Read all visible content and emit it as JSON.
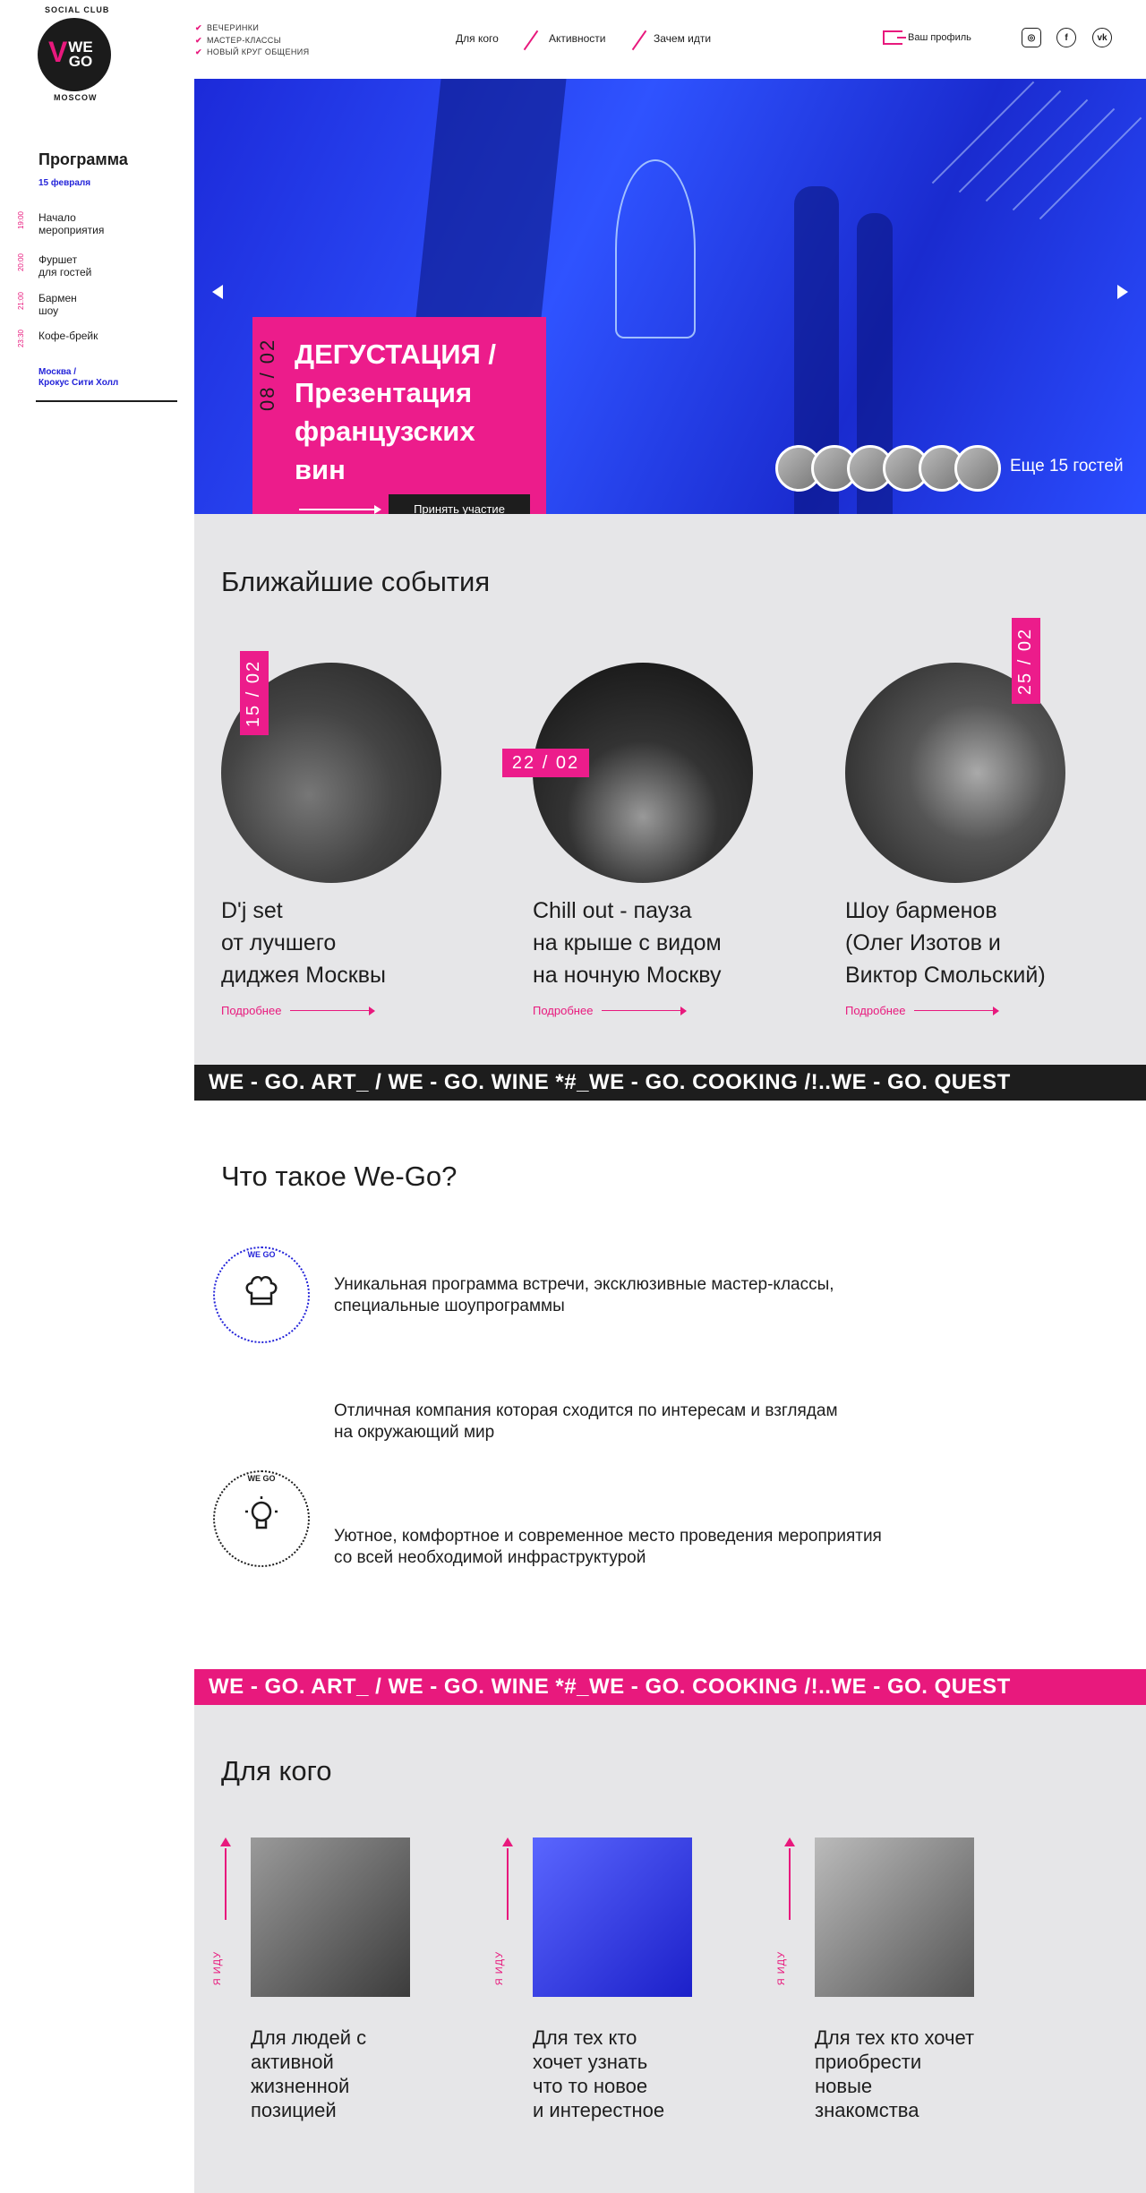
{
  "brand": {
    "ring_top": "SOCIAL CLUB",
    "ring_bottom": "MOSCOW",
    "center": "WE\nGO"
  },
  "checklist": [
    "ВЕЧЕРИНКИ",
    "МАСТЕР-КЛАССЫ",
    "НОВЫЙ КРУГ ОБЩЕНИЯ"
  ],
  "nav": [
    "Для кого",
    "Активности",
    "Зачем идти"
  ],
  "profile_label": "Ваш профиль",
  "socials": [
    "instagram-icon",
    "facebook-icon",
    "vk-icon"
  ],
  "program": {
    "title": "Программа",
    "date": "15 февраля",
    "items": [
      {
        "time": "19:00",
        "label": "Начало\nмероприятия"
      },
      {
        "time": "20:00",
        "label": "Фуршет\nдля гостей"
      },
      {
        "time": "21:00",
        "label": "Бармен\nшоу"
      },
      {
        "time": "23:30",
        "label": "Кофе-брейк"
      }
    ],
    "location": "Москва /\nКрокус Сити Холл"
  },
  "hero": {
    "date": "08 / 02",
    "title": "ДЕГУСТАЦИЯ /\nПрезентация\nфранцузских\nвин",
    "cta": "Принять участие",
    "guests_label": "Еще 15 гостей",
    "avatars_count": 6
  },
  "events": {
    "heading": "Ближайшие события",
    "items": [
      {
        "date": "15 / 02",
        "title": "D'j set\nот лучшего\nдиджея Москвы",
        "more": "Подробнее"
      },
      {
        "date": "22 / 02",
        "title": "Chill out - пауза\nна крыше с видом\nна ночную Москву",
        "more": "Подробнее"
      },
      {
        "date": "25 / 02",
        "title": "Шоу барменов\n(Олег Изотов и\nВиктор Смольский)",
        "more": "Подробнее"
      }
    ]
  },
  "ticker_text": "WE - GO. ART_ / WE - GO. WINE *#_WE - GO. COOKING /!..WE - GO. QUEST",
  "about": {
    "heading": "Что такое We-Go?",
    "badge_text": "WE GO",
    "features": [
      {
        "icon": "chef-hat-icon",
        "color": "#2323d9",
        "text": "Уникальная программа встречи, эксклюзивные мастер-классы,\nспециальные шоупрограммы"
      },
      {
        "icon": "lightbulb-icon",
        "color": "#1d1d1d",
        "text": "Отличная компания которая сходится по интересам и взглядам\nна окружающий мир"
      },
      {
        "icon": "paper-plane-icon",
        "color": "#e8197d",
        "text": "Уютное, комфортное и современное место проведения мероприятия\nсо всей необходимой инфраструктурой"
      }
    ]
  },
  "audience": {
    "heading": "Для кого",
    "side_label": "Я ИДУ",
    "items": [
      {
        "title": "Для людей с\nактивной\nжизненной\nпозицией"
      },
      {
        "title": "Для тех кто\nхочет узнать\nчто то новое\nи интерестное"
      },
      {
        "title": "Для тех кто хочет\nприобрести\nновые\nзнакомства"
      }
    ]
  },
  "colors": {
    "accent": "#e8197d",
    "blue": "#2323d9",
    "dark": "#1d1d1d",
    "grey": "#e6e6e8"
  }
}
